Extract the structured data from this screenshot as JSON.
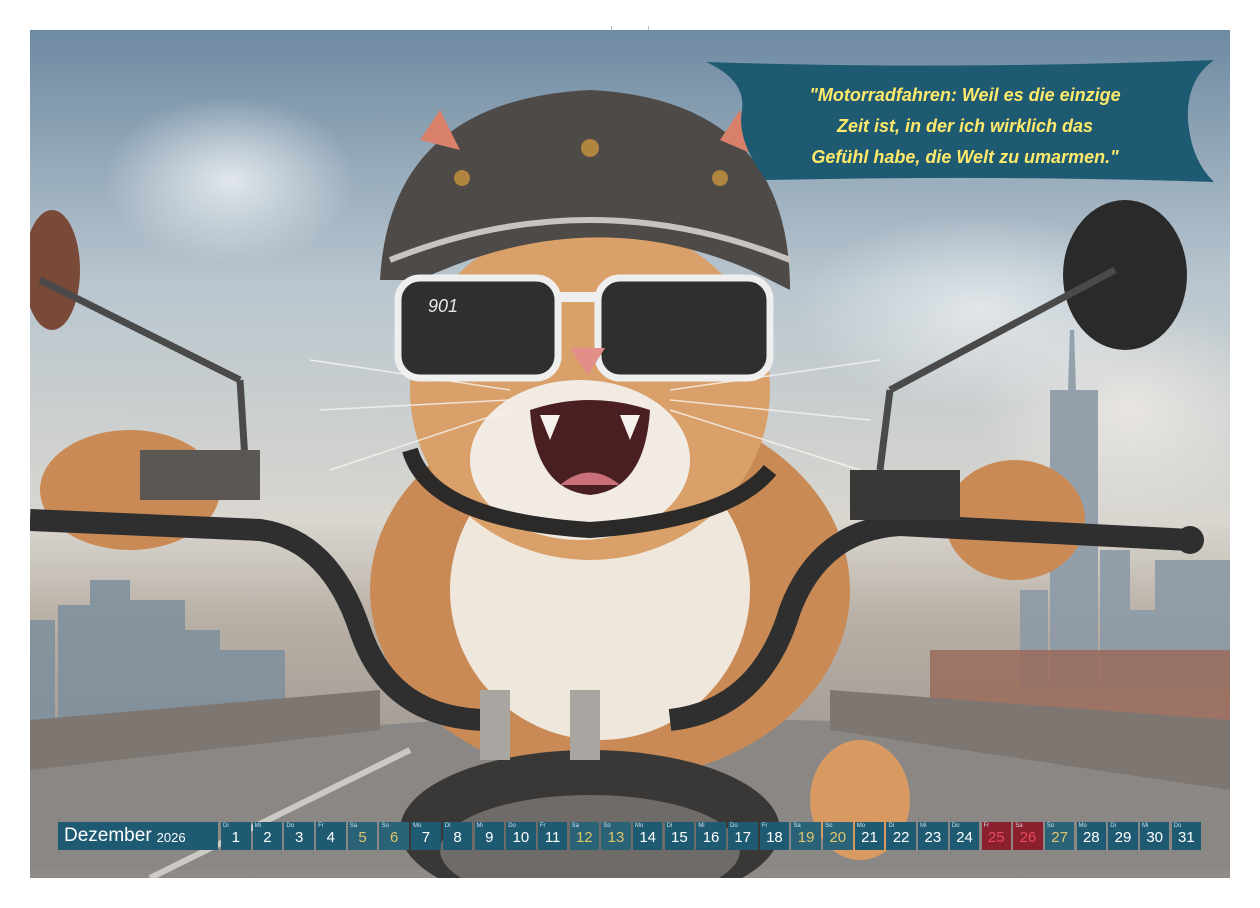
{
  "quote": {
    "line1": "\"Motorradfahren: Weil es die einzige",
    "line2": "Zeit ist, in der ich wirklich das",
    "line3": "Gefühl habe, die Welt zu umarmen.\""
  },
  "helmet_text": "901",
  "calendar": {
    "month": "Dezember",
    "year": "2026",
    "days": [
      {
        "wd": "Di",
        "n": "1",
        "kind": "wd"
      },
      {
        "wd": "Mi",
        "n": "2",
        "kind": "wd"
      },
      {
        "wd": "Do",
        "n": "3",
        "kind": "wd"
      },
      {
        "wd": "Fr",
        "n": "4",
        "kind": "wd"
      },
      {
        "wd": "Sa",
        "n": "5",
        "kind": "sat"
      },
      {
        "wd": "So",
        "n": "6",
        "kind": "sun"
      },
      {
        "wd": "Mo",
        "n": "7",
        "kind": "wd"
      },
      {
        "wd": "Di",
        "n": "8",
        "kind": "wd"
      },
      {
        "wd": "Mi",
        "n": "9",
        "kind": "wd"
      },
      {
        "wd": "Do",
        "n": "10",
        "kind": "wd"
      },
      {
        "wd": "Fr",
        "n": "11",
        "kind": "wd"
      },
      {
        "wd": "Sa",
        "n": "12",
        "kind": "sat"
      },
      {
        "wd": "So",
        "n": "13",
        "kind": "sun"
      },
      {
        "wd": "Mo",
        "n": "14",
        "kind": "wd"
      },
      {
        "wd": "Di",
        "n": "15",
        "kind": "wd"
      },
      {
        "wd": "Mi",
        "n": "16",
        "kind": "wd"
      },
      {
        "wd": "Do",
        "n": "17",
        "kind": "wd"
      },
      {
        "wd": "Fr",
        "n": "18",
        "kind": "wd"
      },
      {
        "wd": "Sa",
        "n": "19",
        "kind": "sat"
      },
      {
        "wd": "So",
        "n": "20",
        "kind": "sun"
      },
      {
        "wd": "Mo",
        "n": "21",
        "kind": "wd"
      },
      {
        "wd": "Di",
        "n": "22",
        "kind": "wd"
      },
      {
        "wd": "Mi",
        "n": "23",
        "kind": "wd"
      },
      {
        "wd": "Do",
        "n": "24",
        "kind": "wd"
      },
      {
        "wd": "Fr",
        "n": "25",
        "kind": "hol"
      },
      {
        "wd": "Sa",
        "n": "26",
        "kind": "hol"
      },
      {
        "wd": "So",
        "n": "27",
        "kind": "sun"
      },
      {
        "wd": "Mo",
        "n": "28",
        "kind": "wd"
      },
      {
        "wd": "Di",
        "n": "29",
        "kind": "wd"
      },
      {
        "wd": "Mi",
        "n": "30",
        "kind": "wd"
      },
      {
        "wd": "Do",
        "n": "31",
        "kind": "wd"
      }
    ]
  }
}
